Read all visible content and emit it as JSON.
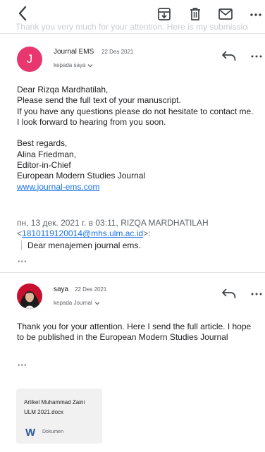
{
  "toolbar": {
    "back_icon": "chevron-left-icon",
    "archive_icon": "archive-icon",
    "delete_icon": "trash-icon",
    "mark_unread_icon": "envelope-icon",
    "more_icon": "more-horizontal-icon"
  },
  "thread_subject_partial": "Thank you very much for your attention. Here is my submission",
  "messages": [
    {
      "avatar_letter": "J",
      "sender": "Journal EMS",
      "date": "22 Des 2021",
      "recipient": "kepada saya",
      "body": [
        "Dear Rizqa Mardhatilah,",
        "Please send the full text of your manuscript.",
        "If you have any questions please do not hesitate to contact me.",
        "I look forward to hearing from you soon.",
        "",
        "Best regards,",
        "Alina Friedman,",
        "Editor-in-Chief",
        "European Modern Studies Journal"
      ],
      "link": "www.journal-ems.com",
      "quote_header_1": "пн, 13 дек. 2021 г. в 03:11, RIZQA MARDHATILAH",
      "quote_email": "1810119120014@mhs.ulm.ac.id",
      "quote_open": "<",
      "quote_close": ">:",
      "quote_text": "Dear menajemen journal ems.",
      "ellipsis": "•••"
    },
    {
      "sender": "saya",
      "date": "22 Des 2021",
      "recipient": "kepada Journal",
      "body": "Thank you for your attention. Here I send the full article. I hope to be published in the European Modern Studies Journal",
      "ellipsis": "•••",
      "attachment": {
        "name": "Artikel Muhammad Zaini ULM 2021.docx",
        "type": "Dokumen"
      }
    }
  ],
  "colors": {
    "avatar_j": "#e8366f",
    "link": "#1a73e8",
    "word_blue": "#2b579a"
  }
}
